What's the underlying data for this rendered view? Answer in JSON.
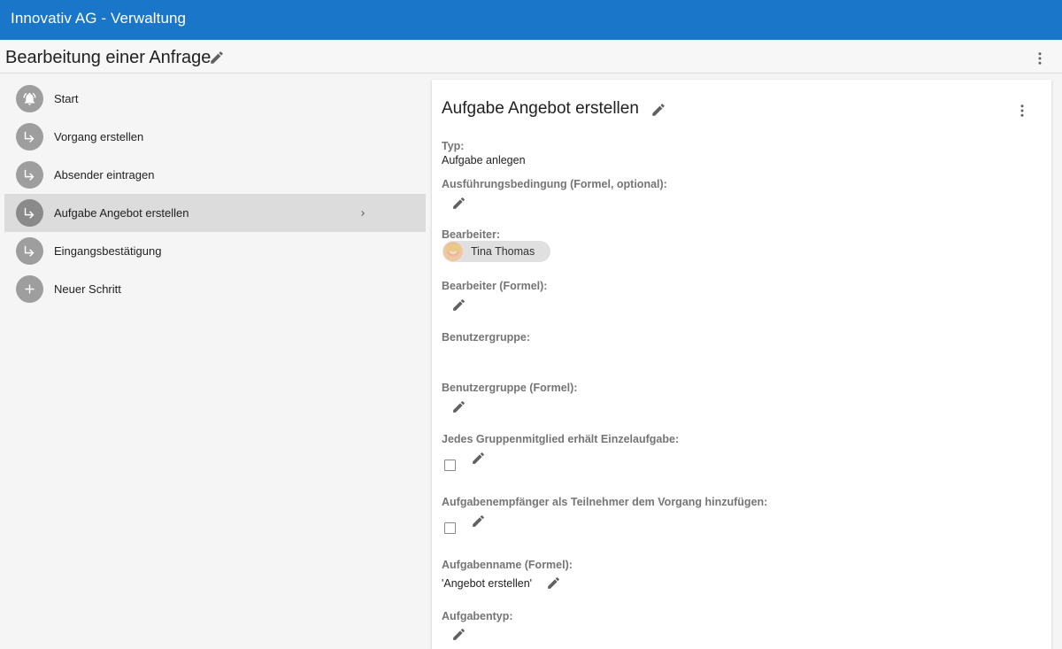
{
  "app": {
    "title": "Innovativ AG - Verwaltung"
  },
  "page": {
    "title": "Bearbeitung einer Anfrage"
  },
  "steps": [
    {
      "label": "Start",
      "icon": "bell-icon"
    },
    {
      "label": "Vorgang erstellen",
      "icon": "subdirectory-arrow-icon"
    },
    {
      "label": "Absender eintragen",
      "icon": "subdirectory-arrow-icon"
    },
    {
      "label": "Aufgabe Angebot erstellen",
      "icon": "subdirectory-arrow-icon",
      "active": true
    },
    {
      "label": "Eingangsbestätigung",
      "icon": "subdirectory-arrow-icon"
    },
    {
      "label": "Neuer Schritt",
      "icon": "plus-icon"
    }
  ],
  "detail": {
    "title": "Aufgabe Angebot erstellen",
    "typ_label": "Typ:",
    "typ_value": "Aufgabe anlegen",
    "condition_label": "Ausführungsbedingung (Formel, optional):",
    "assignee_label": "Bearbeiter:",
    "assignee_name": "Tina Thomas",
    "assignee_formula_label": "Bearbeiter (Formel):",
    "usergroup_label": "Benutzergruppe:",
    "usergroup_formula_label": "Benutzergruppe (Formel):",
    "each_member_label": "Jedes Gruppenmitglied erhält Einzelaufgabe:",
    "each_member_checked": false,
    "add_participants_label": "Aufgabenempfänger als Teilnehmer dem Vorgang hinzufügen:",
    "add_participants_checked": false,
    "taskname_label": "Aufgabenname (Formel):",
    "taskname_value": "'Angebot erstellen'",
    "tasktype_label": "Aufgabentyp:"
  },
  "colors": {
    "appbar": "#1976c9",
    "active_step": "#dcdcdc",
    "step_circle": "#9e9e9e"
  }
}
